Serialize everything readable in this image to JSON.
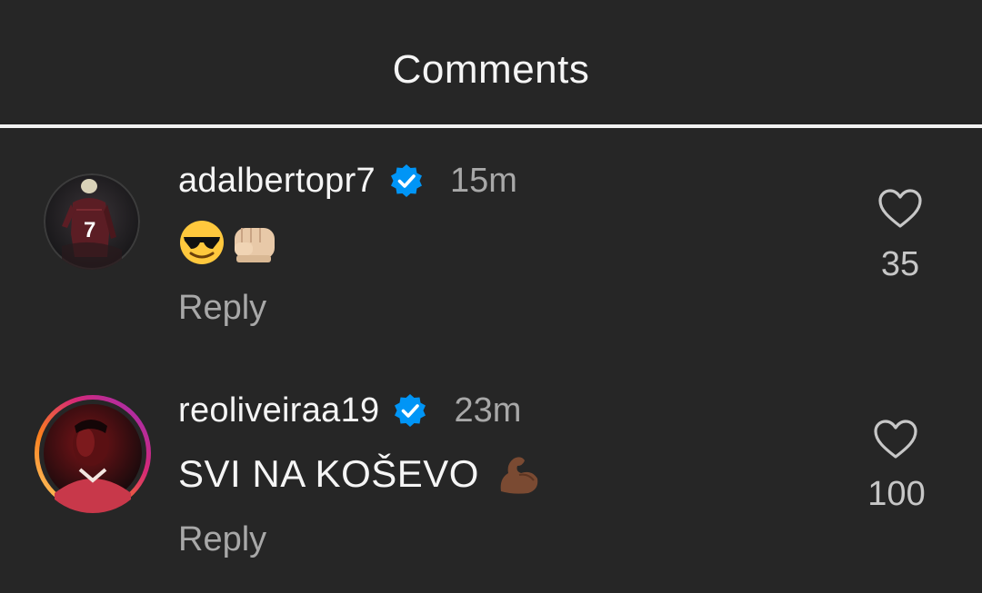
{
  "header": {
    "title": "Comments"
  },
  "comments": [
    {
      "username": "adalbertopr7",
      "verified": true,
      "time": "15m",
      "text": "",
      "emojis": [
        "sunglasses-emoji",
        "fist-bump-emoji"
      ],
      "reply_label": "Reply",
      "likes": "35",
      "avatar_story_ring": false
    },
    {
      "username": "reoliveiraa19",
      "verified": true,
      "time": "23m",
      "text": "SVI NA KOŠEVO",
      "emojis": [
        "flexed-biceps-emoji"
      ],
      "reply_label": "Reply",
      "likes": "100",
      "avatar_story_ring": true
    }
  ],
  "colors": {
    "background": "#262626",
    "verified_blue": "#0095f6",
    "secondary_text": "#a8a8a8",
    "divider": "#f2f2f2"
  },
  "icons": {
    "like": "heart-outline-icon",
    "verified": "verified-badge-icon"
  }
}
